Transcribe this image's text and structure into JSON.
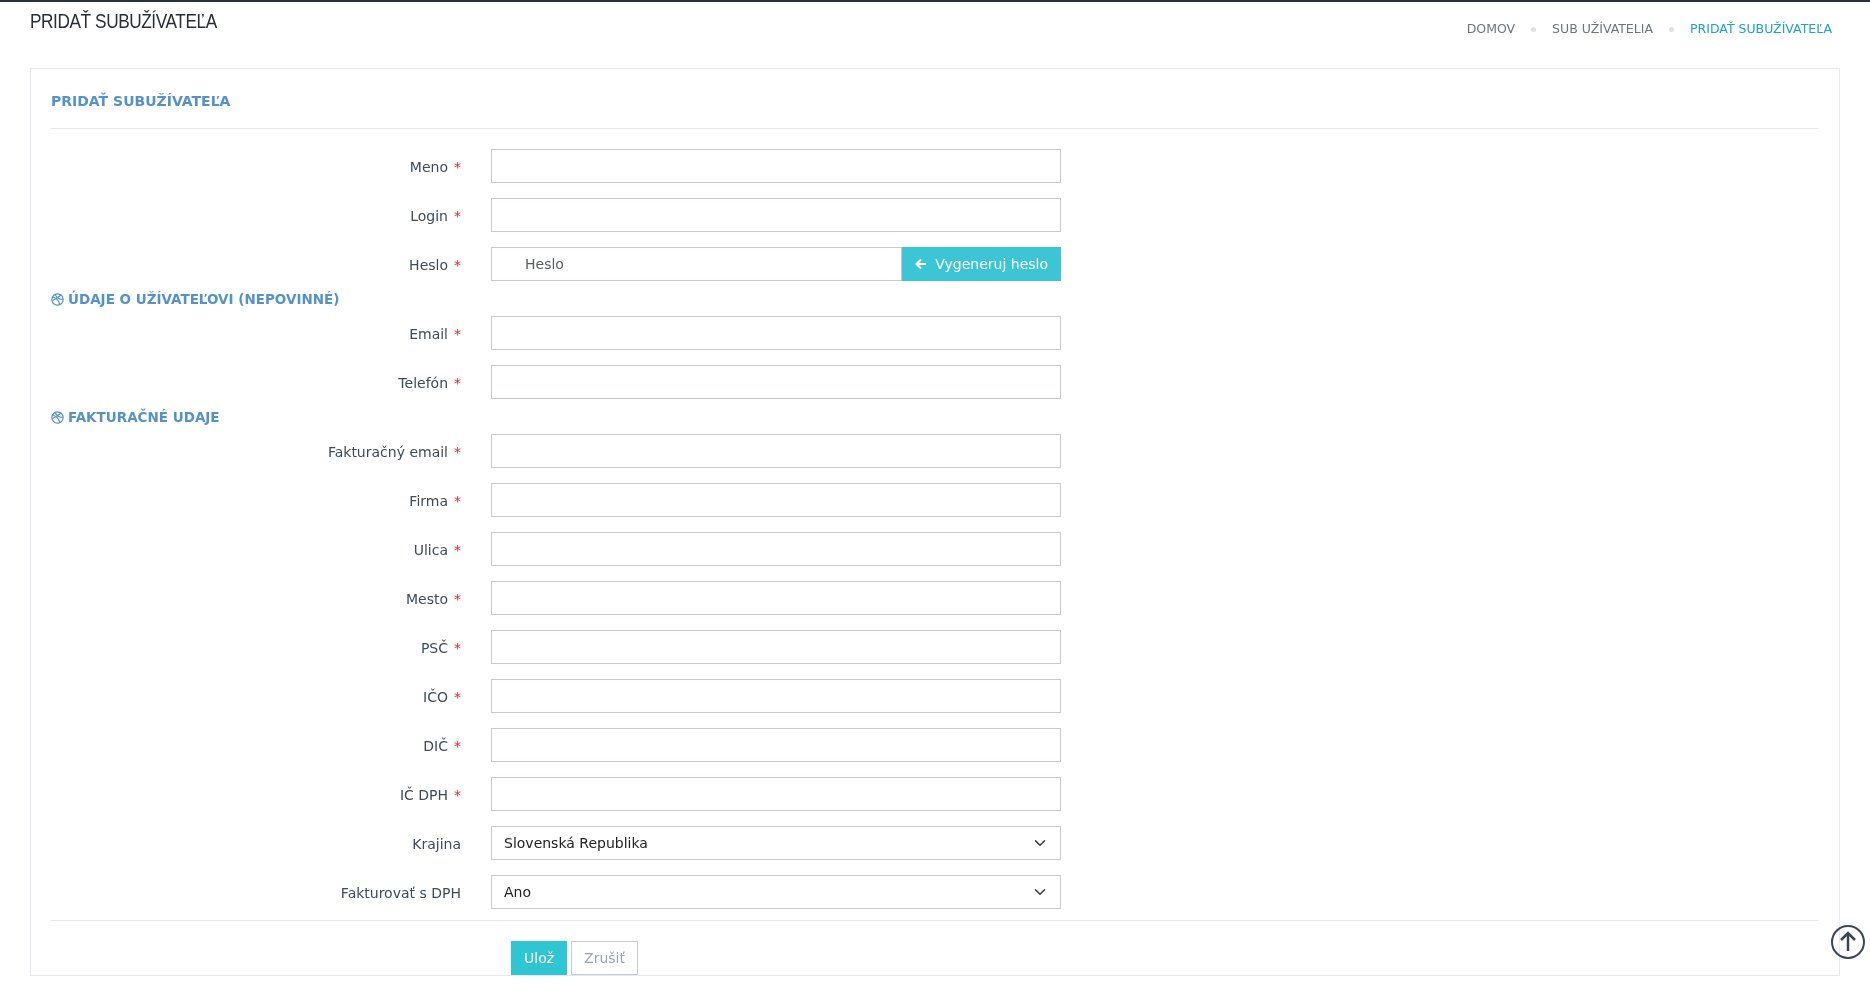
{
  "page_title": "PRIDAŤ SUBUŽÍVATEĽA",
  "breadcrumb": [
    {
      "label": "DOMOV",
      "selected": false
    },
    {
      "label": "SUB UŽÍVATELIA",
      "selected": false
    },
    {
      "label": "PRIDAŤ SUBUŽÍVATEĽA",
      "selected": true
    }
  ],
  "card_title": "PRIDAŤ SUBUŽÍVATEĽA",
  "sections": [
    {
      "fields": [
        {
          "kind": "text",
          "label": "Meno",
          "required_mark": "*"
        },
        {
          "kind": "text",
          "label": "Login",
          "required_mark": "*"
        },
        {
          "kind": "password",
          "label": "Heslo",
          "required_mark": "*",
          "placeholder": "Heslo",
          "button": "Vygeneruj heslo"
        }
      ]
    },
    {
      "heading": "ÚDAJE O UŽÍVATEĽOVI (NEPOVINNÉ)",
      "fields": [
        {
          "kind": "text",
          "label": "Email",
          "required_mark": "*"
        },
        {
          "kind": "text",
          "label": "Telefón",
          "required_mark": "*"
        }
      ]
    },
    {
      "heading": "FAKTURAČNÉ UDAJE",
      "fields": [
        {
          "kind": "text",
          "label": "Fakturačný email",
          "required_mark": "*"
        },
        {
          "kind": "text",
          "label": "Firma",
          "required_mark": "*"
        },
        {
          "kind": "text",
          "label": "Ulica",
          "required_mark": "*"
        },
        {
          "kind": "text",
          "label": "Mesto",
          "required_mark": "*"
        },
        {
          "kind": "text",
          "label": "PSČ",
          "required_mark": "*"
        },
        {
          "kind": "text",
          "label": "IČO",
          "required_mark": "*"
        },
        {
          "kind": "text",
          "label": "DIČ",
          "required_mark": "*"
        },
        {
          "kind": "text",
          "label": "IČ DPH",
          "required_mark": "*"
        },
        {
          "kind": "select",
          "label": "Krajina",
          "value": "Slovenská Republika"
        },
        {
          "kind": "select",
          "label": "Fakturovať s DPH",
          "value": "Ano"
        }
      ]
    }
  ],
  "buttons": [
    {
      "kind": "primary",
      "label": "Ulož"
    },
    {
      "kind": "secondary",
      "label": "Zrušiť"
    }
  ]
}
